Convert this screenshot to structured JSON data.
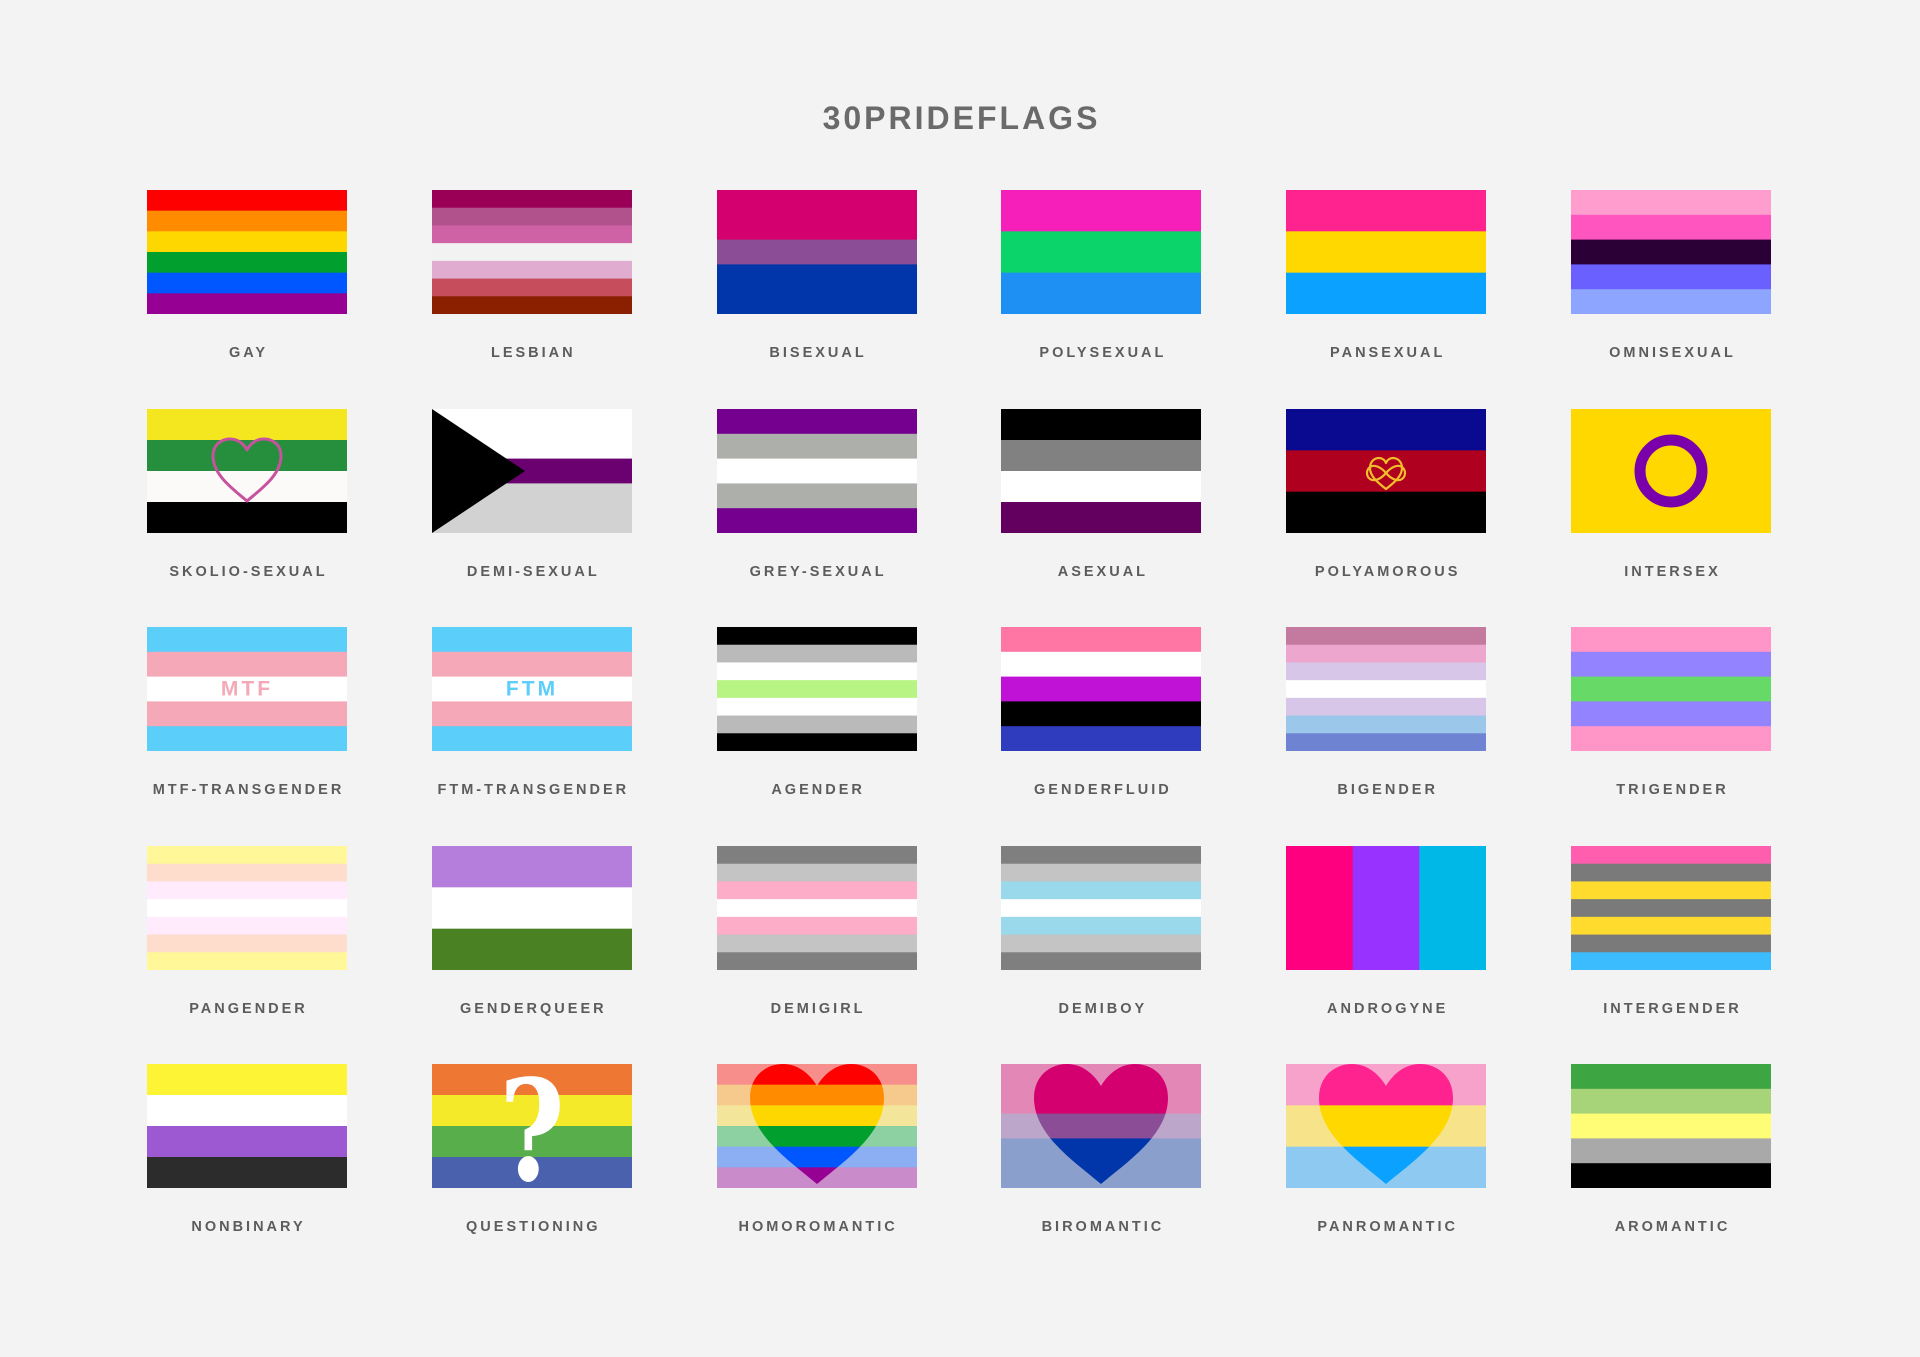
{
  "title": "30PRIDEFLAGS",
  "background": "#F3F3F3",
  "flags": [
    {
      "label": "GAY",
      "orientation": "horizontal",
      "stripes": [
        "#FF0000",
        "#FF8C00",
        "#FFD700",
        "#009F2E",
        "#0057FF",
        "#960093"
      ]
    },
    {
      "label": "LESBIAN",
      "orientation": "horizontal",
      "stripes": [
        "#9A0055",
        "#B2528D",
        "#CE62A5",
        "#F2F2F2",
        "#E0ADD1",
        "#C64E5C",
        "#8A2000"
      ]
    },
    {
      "label": "BISEXUAL",
      "orientation": "horizontal",
      "stripes": [
        "#D5006F",
        "#D5006F",
        "#8A4D96",
        "#0036AA",
        "#0036AA"
      ]
    },
    {
      "label": "POLYSEXUAL",
      "orientation": "horizontal",
      "stripes": [
        "#F61FB9",
        "#0AD46A",
        "#1E90F4"
      ]
    },
    {
      "label": "PANSEXUAL",
      "orientation": "horizontal",
      "stripes": [
        "#FF2390",
        "#FFD800",
        "#0AA1FF"
      ]
    },
    {
      "label": "OMNISEXUAL",
      "orientation": "horizontal",
      "stripes": [
        "#FF9DCE",
        "#FF55BF",
        "#2A0036",
        "#6A5FFF",
        "#8EA5FF"
      ]
    },
    {
      "label": "SKOLIO-SEXUAL",
      "orientation": "horizontal",
      "stripes": [
        "#F4E71F",
        "#258F3E",
        "#FBFAF8",
        "#000000"
      ],
      "emblem": {
        "type": "heart-outline",
        "color": "#C7529E"
      }
    },
    {
      "label": "DEMI-SEXUAL",
      "orientation": "horizontal",
      "stripes": [
        "#FFFFFF",
        "#FFFFFF",
        "#6B0071",
        "#D2D2D2",
        "#D2D2D2"
      ],
      "emblem": {
        "type": "demi-triangle",
        "color": "#000000"
      }
    },
    {
      "label": "GREY-SEXUAL",
      "orientation": "horizontal",
      "stripes": [
        "#75008F",
        "#ADB0AA",
        "#FFFFFF",
        "#ADB0AA",
        "#75008F"
      ]
    },
    {
      "label": "ASEXUAL",
      "orientation": "horizontal",
      "stripes": [
        "#000000",
        "#818181",
        "#FFFFFF",
        "#63005F"
      ]
    },
    {
      "label": "POLYAMOROUS",
      "orientation": "horizontal",
      "stripes": [
        "#0A0A90",
        "#B0001F",
        "#000000"
      ],
      "emblem": {
        "type": "infinity-heart",
        "color": "#F0BE2A"
      }
    },
    {
      "label": "INTERSEX",
      "orientation": "horizontal",
      "stripes": [
        "#FFD800"
      ],
      "emblem": {
        "type": "ring",
        "color": "#7A00AC"
      }
    },
    {
      "label": "MTF-TRANSGENDER",
      "orientation": "horizontal",
      "stripes": [
        "#5BCEFA",
        "#F5A9B8",
        "#FFFFFF",
        "#F5A9B8",
        "#5BCEFA"
      ],
      "emblem": {
        "type": "text",
        "text": "MTF",
        "color": "#F5A9B8"
      }
    },
    {
      "label": "FTM-TRANSGENDER",
      "orientation": "horizontal",
      "stripes": [
        "#5BCEFA",
        "#F5A9B8",
        "#FFFFFF",
        "#F5A9B8",
        "#5BCEFA"
      ],
      "emblem": {
        "type": "text",
        "text": "FTM",
        "color": "#5BCEFA"
      }
    },
    {
      "label": "AGENDER",
      "orientation": "horizontal",
      "stripes": [
        "#000000",
        "#BABABA",
        "#FFFFFF",
        "#B8F483",
        "#FFFFFF",
        "#BABABA",
        "#000000"
      ]
    },
    {
      "label": "GENDERFLUID",
      "orientation": "horizontal",
      "stripes": [
        "#FF76A4",
        "#FFFFFF",
        "#C011D7",
        "#000000",
        "#2F3CBE"
      ]
    },
    {
      "label": "BIGENDER",
      "orientation": "horizontal",
      "stripes": [
        "#C4799F",
        "#EDA6CD",
        "#D7C6E7",
        "#FFFFFF",
        "#D7C6E7",
        "#9AC7EA",
        "#6E83D2"
      ]
    },
    {
      "label": "TRIGENDER",
      "orientation": "horizontal",
      "stripes": [
        "#FF96C7",
        "#9483FF",
        "#67D966",
        "#9483FF",
        "#FF96C7"
      ]
    },
    {
      "label": "PANGENDER",
      "orientation": "horizontal",
      "stripes": [
        "#FFF798",
        "#FEDDCD",
        "#FFEBFB",
        "#FFFFFF",
        "#FFEBFB",
        "#FEDDCD",
        "#FFF798"
      ]
    },
    {
      "label": "GENDERQUEER",
      "orientation": "horizontal",
      "stripes": [
        "#B57EDC",
        "#FFFFFF",
        "#4A8123"
      ]
    },
    {
      "label": "DEMIGIRL",
      "orientation": "horizontal",
      "stripes": [
        "#7F7F7F",
        "#C4C4C4",
        "#FDADC8",
        "#FFFFFF",
        "#FDADC8",
        "#C4C4C4",
        "#7F7F7F"
      ]
    },
    {
      "label": "DEMIBOY",
      "orientation": "horizontal",
      "stripes": [
        "#7F7F7F",
        "#C4C4C4",
        "#9AD9EB",
        "#FFFFFF",
        "#9AD9EB",
        "#C4C4C4",
        "#7F7F7F"
      ]
    },
    {
      "label": "ANDROGYNE",
      "orientation": "vertical",
      "stripes": [
        "#FE007F",
        "#9832FF",
        "#00B8E7"
      ]
    },
    {
      "label": "INTERGENDER",
      "orientation": "horizontal",
      "stripes": [
        "#FF5DAE",
        "#7A7A7A",
        "#FFDB2E",
        "#7A7A7A",
        "#FFDB2E",
        "#7A7A7A",
        "#3BBCFF"
      ]
    },
    {
      "label": "NONBINARY",
      "orientation": "horizontal",
      "stripes": [
        "#FCF434",
        "#FFFFFF",
        "#9C59D1",
        "#2C2C2C"
      ]
    },
    {
      "label": "QUESTIONING",
      "orientation": "horizontal",
      "stripes": [
        "#EE7733",
        "#F4EA2A",
        "#58AE4A",
        "#4A62AE"
      ],
      "emblem": {
        "type": "question-mark",
        "text": "?",
        "color": "#FFFFFF"
      }
    },
    {
      "label": "HOMOROMANTIC",
      "orientation": "horizontal",
      "stripes": [
        "#F78E8B",
        "#F6C98C",
        "#F3E599",
        "#8DD1A2",
        "#8CAEF2",
        "#C98BC9"
      ],
      "emblem": {
        "type": "heart",
        "stripes": [
          "#FF0000",
          "#FF8C00",
          "#FFD700",
          "#009F2E",
          "#0057FF",
          "#960093"
        ]
      }
    },
    {
      "label": "BIROMANTIC",
      "orientation": "horizontal",
      "stripes": [
        "#E387B6",
        "#E387B6",
        "#BCA7CA",
        "#8A9FCC",
        "#8A9FCC"
      ],
      "emblem": {
        "type": "heart",
        "stripes": [
          "#D5006F",
          "#D5006F",
          "#8A4D96",
          "#0036AA",
          "#0036AA"
        ]
      }
    },
    {
      "label": "PANROMANTIC",
      "orientation": "horizontal",
      "stripes": [
        "#F7A2CB",
        "#F6E38A",
        "#8EC9F1"
      ],
      "emblem": {
        "type": "heart",
        "stripes": [
          "#FF2390",
          "#FFD800",
          "#0AA1FF"
        ]
      }
    },
    {
      "label": "AROMANTIC",
      "orientation": "horizontal",
      "stripes": [
        "#3DA542",
        "#A7D379",
        "#FFFD75",
        "#A9A9A9",
        "#000000"
      ]
    }
  ]
}
